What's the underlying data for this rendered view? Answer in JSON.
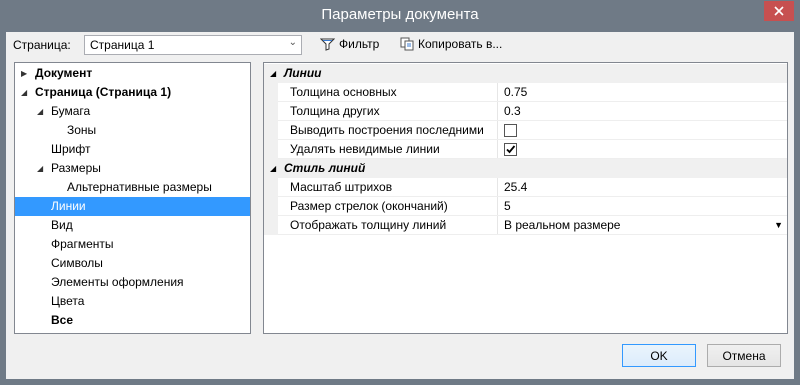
{
  "window": {
    "title": "Параметры документа"
  },
  "toolbar": {
    "page_label": "Страница:",
    "page_select_value": "Страница 1",
    "filter_label": "Фильтр",
    "copy_label": "Копировать в..."
  },
  "tree": {
    "items": [
      {
        "label": "Документ"
      },
      {
        "label": "Страница (Страница 1)"
      },
      {
        "label": "Бумага"
      },
      {
        "label": "Зоны"
      },
      {
        "label": "Шрифт"
      },
      {
        "label": "Размеры"
      },
      {
        "label": "Альтернативные размеры"
      },
      {
        "label": "Линии"
      },
      {
        "label": "Вид"
      },
      {
        "label": "Фрагменты"
      },
      {
        "label": "Символы"
      },
      {
        "label": "Элементы оформления"
      },
      {
        "label": "Цвета"
      },
      {
        "label": "Все"
      }
    ]
  },
  "props": {
    "cat1": "Линии",
    "r1_name": "Толщина основных",
    "r1_value": "0.75",
    "r2_name": "Толщина других",
    "r2_value": "0.3",
    "r3_name": "Выводить построения последними",
    "r3_checked": false,
    "r4_name": "Удалять невидимые линии",
    "r4_checked": true,
    "cat2": "Стиль линий",
    "r5_name": "Масштаб штрихов",
    "r5_value": "25.4",
    "r6_name": "Размер стрелок (окончаний)",
    "r6_value": "5",
    "r7_name": "Отображать толщину линий",
    "r7_value": "В реальном размере"
  },
  "buttons": {
    "ok": "OK",
    "cancel": "Отмена"
  },
  "colors": {
    "frame": "#6f7a86",
    "selection": "#3399ff",
    "close": "#c75050"
  }
}
